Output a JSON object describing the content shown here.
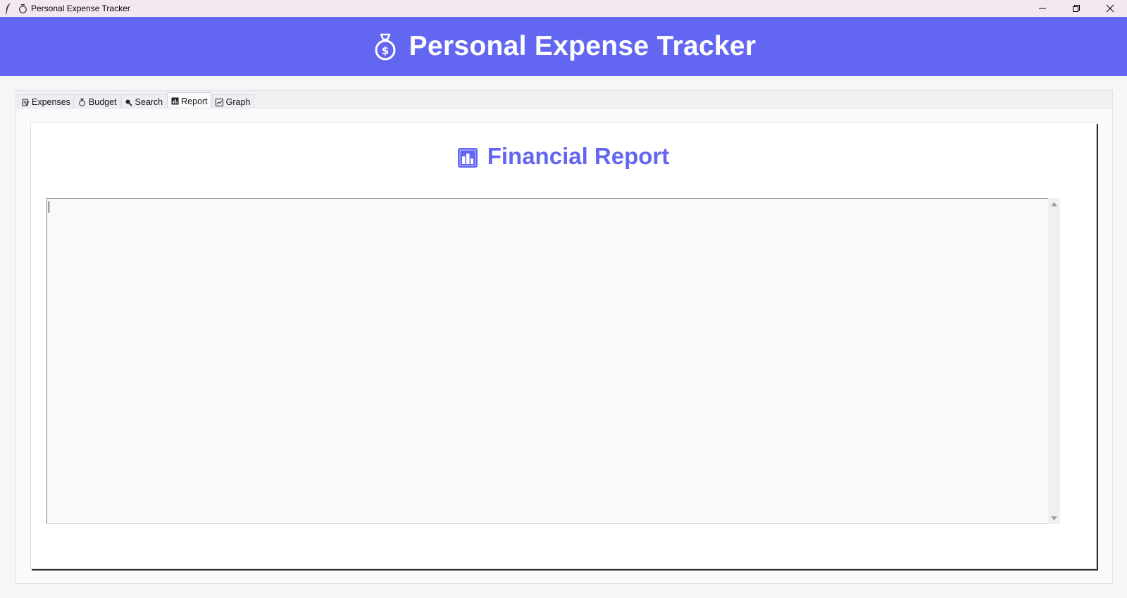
{
  "window": {
    "title": "Personal Expense Tracker"
  },
  "header": {
    "title": "Personal Expense Tracker",
    "icon": "money-bag-icon"
  },
  "tabs": [
    {
      "label": "Expenses",
      "icon": "memo-icon",
      "active": false
    },
    {
      "label": "Budget",
      "icon": "money-bag-icon",
      "active": false
    },
    {
      "label": "Search",
      "icon": "magnifier-icon",
      "active": false
    },
    {
      "label": "Report",
      "icon": "bar-chart-icon",
      "active": true
    },
    {
      "label": "Graph",
      "icon": "chart-icon",
      "active": false
    }
  ],
  "report": {
    "title": "Financial Report",
    "icon": "bar-chart-icon",
    "content": ""
  },
  "colors": {
    "accent": "#6366f1",
    "titlebar": "#f4e8f0",
    "page_bg": "#f9fafb"
  }
}
